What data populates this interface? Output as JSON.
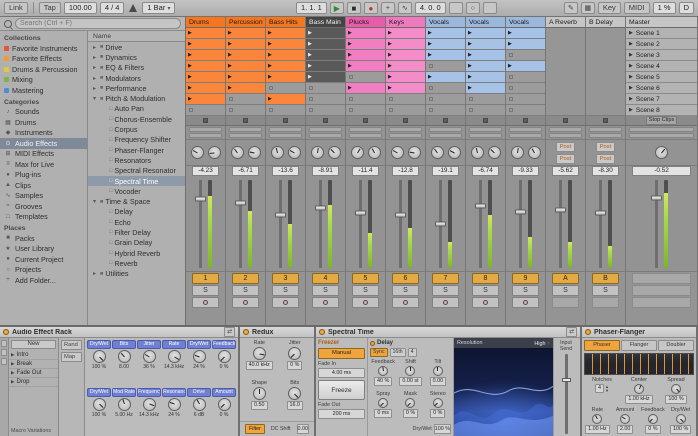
{
  "topbar": {
    "link": "Link",
    "tap": "Tap",
    "tempo": "100.00",
    "signature": "4 / 4",
    "quantize": "1 Bar",
    "position": "1. 1. 1",
    "loop_length": "4. 0. 0",
    "key": "Key",
    "midi": "MIDI",
    "cpu": "1 %",
    "disk": "D"
  },
  "browser": {
    "search_placeholder": "Search (Ctrl + F)",
    "sections": [
      {
        "title": "Collections",
        "items": [
          {
            "label": "Favorite Instruments",
            "icon": "collection-red-icon",
            "color": "#e5533c"
          },
          {
            "label": "Favorite Effects",
            "icon": "collection-orange-icon",
            "color": "#f39b2d"
          },
          {
            "label": "Drums & Percussion",
            "icon": "collection-yellow-icon",
            "color": "#e3c83a"
          },
          {
            "label": "Mixing",
            "icon": "collection-green-icon",
            "color": "#83b33e"
          },
          {
            "label": "Mastering",
            "icon": "collection-blue-icon",
            "color": "#4a8fd4"
          }
        ]
      },
      {
        "title": "Categories",
        "items": [
          {
            "label": "Sounds",
            "icon": "sounds-icon",
            "glyph": "♪"
          },
          {
            "label": "Drums",
            "icon": "drums-icon",
            "glyph": "▦"
          },
          {
            "label": "Instruments",
            "icon": "instruments-icon",
            "glyph": "◆"
          },
          {
            "label": "Audio Effects",
            "icon": "audio-effects-icon",
            "glyph": "⊙",
            "selected": true
          },
          {
            "label": "MIDI Effects",
            "icon": "midi-effects-icon",
            "glyph": "⊞"
          },
          {
            "label": "Max for Live",
            "icon": "max-for-live-icon",
            "glyph": "≡"
          },
          {
            "label": "Plug-ins",
            "icon": "plug-ins-icon",
            "glyph": "●"
          },
          {
            "label": "Clips",
            "icon": "clips-icon",
            "glyph": "▲"
          },
          {
            "label": "Samples",
            "icon": "samples-icon",
            "glyph": "∿"
          },
          {
            "label": "Grooves",
            "icon": "grooves-icon",
            "glyph": "≈"
          },
          {
            "label": "Templates",
            "icon": "templates-icon",
            "glyph": "□"
          }
        ]
      },
      {
        "title": "Places",
        "items": [
          {
            "label": "Packs",
            "icon": "packs-icon",
            "glyph": "■"
          },
          {
            "label": "User Library",
            "icon": "user-library-icon",
            "glyph": "★"
          },
          {
            "label": "Current Project",
            "icon": "current-project-icon",
            "glyph": "●"
          },
          {
            "label": "Projects",
            "icon": "projects-icon",
            "glyph": "○"
          },
          {
            "label": "Add Folder...",
            "icon": "add-folder-icon",
            "glyph": "+"
          }
        ]
      }
    ],
    "content": {
      "header": "Name",
      "items": [
        {
          "label": "Drive",
          "type": "folder",
          "depth": 0
        },
        {
          "label": "Dynamics",
          "type": "folder",
          "depth": 0
        },
        {
          "label": "EQ & Filters",
          "type": "folder",
          "depth": 0
        },
        {
          "label": "Modulators",
          "type": "folder",
          "depth": 0
        },
        {
          "label": "Performance",
          "type": "folder",
          "depth": 0
        },
        {
          "label": "Pitch & Modulation",
          "type": "folder",
          "depth": 0,
          "expanded": true
        },
        {
          "label": "Auto Pan",
          "type": "device",
          "depth": 1
        },
        {
          "label": "Chorus-Ensemble",
          "type": "device",
          "depth": 1
        },
        {
          "label": "Corpus",
          "type": "device",
          "depth": 1
        },
        {
          "label": "Frequency Shifter",
          "type": "device",
          "depth": 1
        },
        {
          "label": "Phaser-Flanger",
          "type": "device",
          "depth": 1
        },
        {
          "label": "Resonators",
          "type": "device",
          "depth": 1
        },
        {
          "label": "Spectral Resonator",
          "type": "device",
          "depth": 1
        },
        {
          "label": "Spectral Time",
          "type": "device",
          "depth": 1,
          "selected": true
        },
        {
          "label": "Vocoder",
          "type": "device",
          "depth": 1
        },
        {
          "label": "Time & Space",
          "type": "folder",
          "depth": 0,
          "expanded": true
        },
        {
          "label": "Delay",
          "type": "device",
          "depth": 1
        },
        {
          "label": "Echo",
          "type": "device",
          "depth": 1
        },
        {
          "label": "Filter Delay",
          "type": "device",
          "depth": 1
        },
        {
          "label": "Grain Delay",
          "type": "device",
          "depth": 1
        },
        {
          "label": "Hybrid Reverb",
          "type": "device",
          "depth": 1
        },
        {
          "label": "Reverb",
          "type": "device",
          "depth": 1
        },
        {
          "label": "Utilities",
          "type": "folder",
          "depth": 0
        }
      ]
    }
  },
  "session": {
    "solo_label": "S",
    "post_label": "Post",
    "tracks": [
      {
        "name": "Drums",
        "color": "#f5761c",
        "clip_color": "#f9863b",
        "slots": [
          1,
          1,
          1,
          1,
          1,
          1,
          1,
          0
        ],
        "number": "1",
        "volume": "-4.23",
        "fader": 0.78,
        "meter": 0.82
      },
      {
        "name": "Percussion",
        "color": "#f5761c",
        "clip_color": "#f9863b",
        "slots": [
          1,
          1,
          1,
          1,
          1,
          1,
          0,
          0
        ],
        "number": "2",
        "volume": "-6.71",
        "fader": 0.74,
        "meter": 0.65
      },
      {
        "name": "Bass Hits",
        "color": "#f5761c",
        "clip_color": "#f9863b",
        "slots": [
          1,
          1,
          1,
          1,
          1,
          0,
          1,
          0
        ],
        "number": "3",
        "volume": "-13.6",
        "fader": 0.6,
        "meter": 0.5
      },
      {
        "name": "Bass Main",
        "color": "#454545",
        "text_light": true,
        "dark_clips": true,
        "clip_color": "#5a5a5a",
        "slots": [
          1,
          1,
          1,
          1,
          1,
          0,
          0,
          0
        ],
        "number": "4",
        "volume": "-8.91",
        "fader": 0.68,
        "meter": 0.72
      },
      {
        "name": "Plucks",
        "color": "#e95caa",
        "clip_color": "#f07ec0",
        "slots": [
          1,
          1,
          1,
          1,
          0,
          1,
          0,
          0
        ],
        "number": "5",
        "volume": "-11.4",
        "fader": 0.62,
        "meter": 0.4
      },
      {
        "name": "Keys",
        "color": "#ef79bd",
        "clip_color": "#f48cc9",
        "slots": [
          1,
          1,
          1,
          1,
          1,
          1,
          0,
          0
        ],
        "number": "6",
        "volume": "-12.8",
        "fader": 0.6,
        "meter": 0.45
      },
      {
        "name": "Vocals",
        "color": "#9cb7dc",
        "clip_color": "#a6c2e6",
        "slots": [
          1,
          1,
          1,
          0,
          1,
          0,
          0,
          0
        ],
        "number": "7",
        "volume": "-19.1",
        "fader": 0.5,
        "meter": 0.3
      },
      {
        "name": "Vocals",
        "color": "#9cb7dc",
        "clip_color": "#a6c2e6",
        "slots": [
          1,
          1,
          1,
          1,
          1,
          1,
          0,
          0
        ],
        "number": "8",
        "volume": "-6.74",
        "fader": 0.7,
        "meter": 0.6
      },
      {
        "name": "Vocals",
        "color": "#9cb7dc",
        "clip_color": "#a6c2e6",
        "slots": [
          1,
          1,
          0,
          1,
          0,
          0,
          0,
          0
        ],
        "number": "9",
        "volume": "-9.33",
        "fader": 0.64,
        "meter": 0.35
      }
    ],
    "returns": [
      {
        "name": "A Reverb",
        "color": "#c6c6c6",
        "number": "A",
        "volume": "-5.62",
        "fader": 0.66,
        "meter": 0.3
      },
      {
        "name": "B Delay",
        "color": "#c6c6c6",
        "number": "B",
        "volume": "-8.30",
        "fader": 0.62,
        "meter": 0.25
      }
    ],
    "master": {
      "name": "Master",
      "color": "#c6c6c6",
      "number": "",
      "volume": "-0.52",
      "fader": 0.8,
      "meter": 0.85,
      "stop_clips": "Stop Clips",
      "scenes": [
        "Scene 1",
        "Scene 2",
        "Scene 3",
        "Scene 4",
        "Scene 5",
        "Scene 6",
        "Scene 7",
        "Scene 8"
      ]
    }
  },
  "devices": {
    "rack": {
      "title": "Audio Effect Rack",
      "rand": "Rand",
      "map": "Map",
      "new_button": "New",
      "variations_label": "Macro Variations",
      "variations": [
        "Intro",
        "Break",
        "Fade Out",
        "Drop"
      ],
      "macros": [
        {
          "label": "Dry/Wet",
          "value": "100 %",
          "angle": 135
        },
        {
          "label": "Bits",
          "value": "8.00",
          "angle": -40
        },
        {
          "label": "Jitter",
          "value": "36 %",
          "angle": -60
        },
        {
          "label": "Rate",
          "value": "14.3 kHz",
          "angle": 120
        },
        {
          "label": "Dry/Wet",
          "value": "24 %",
          "angle": -70
        },
        {
          "label": "Feedback",
          "value": "0 %",
          "angle": -135
        },
        {
          "label": "Dry/Wet",
          "value": "100 %",
          "angle": 135
        },
        {
          "label": "Mod Rate",
          "value": "5.00 Hz",
          "angle": -20
        },
        {
          "label": "Frequency",
          "value": "14.3 kHz",
          "angle": 110
        },
        {
          "label": "Resonance",
          "value": "24 %",
          "angle": -70
        },
        {
          "label": "Drive",
          "value": "6 dB",
          "angle": -30
        },
        {
          "label": "Amount",
          "value": "0 %",
          "angle": -135
        }
      ]
    },
    "redux": {
      "title": "Redux",
      "params": [
        {
          "label": "Rate",
          "value": "40.0 kHz",
          "angle": 100
        },
        {
          "label": "Jitter",
          "value": "0 %",
          "angle": -135
        },
        {
          "label": "Shape",
          "value": "0.50",
          "angle": 0
        },
        {
          "label": "Bits",
          "value": "16.0",
          "angle": 135
        }
      ],
      "filter_label": "Filter",
      "dc_label": "DC Shift",
      "dc_value": "0.00"
    },
    "spectral": {
      "title": "Spectral Time",
      "freezer_header": "Freezer",
      "mode": "Manual",
      "fade_in_label": "Fade In",
      "fade_in": "4.00 ms",
      "freeze": "Freeze",
      "fade_out_label": "Fade Out",
      "fade_out": "200 ms",
      "delay_header": "Delay",
      "sync": "Sync",
      "division": "16th",
      "time": "4",
      "knobs": [
        {
          "label": "Feedback",
          "value": "40 %",
          "angle": -10
        },
        {
          "label": "Shift",
          "value": "0.00 st",
          "angle": 0
        },
        {
          "label": "Tilt",
          "value": "0.00",
          "angle": 0
        },
        {
          "label": "Spray",
          "value": "0 ms",
          "angle": -135
        },
        {
          "label": "Mask",
          "value": "0 %",
          "angle": -135
        },
        {
          "label": "Stereo",
          "value": "0 %",
          "angle": -135
        }
      ],
      "mix_label": "Dry/Wet",
      "mix_value": "100 %",
      "resolution_label": "Resolution",
      "resolution_value": "High",
      "input_send": "Input Send"
    },
    "phaser": {
      "title": "Phaser-Flanger",
      "tabs": [
        "Phaser",
        "Flanger",
        "Doubler"
      ],
      "notches_label": "Notches",
      "notches": "4",
      "center_label": "Center",
      "center": "1.00 kHz",
      "spread_label": "Spread",
      "spread": "100 %",
      "knobs": [
        {
          "label": "Rate",
          "value": "1.00 Hz",
          "angle": -30
        },
        {
          "label": "Amount",
          "value": "2.00",
          "angle": -60
        },
        {
          "label": "Feedback",
          "value": "0 %",
          "angle": -135
        },
        {
          "label": "Dry/Wet",
          "value": "100 %",
          "angle": 135
        }
      ]
    }
  }
}
